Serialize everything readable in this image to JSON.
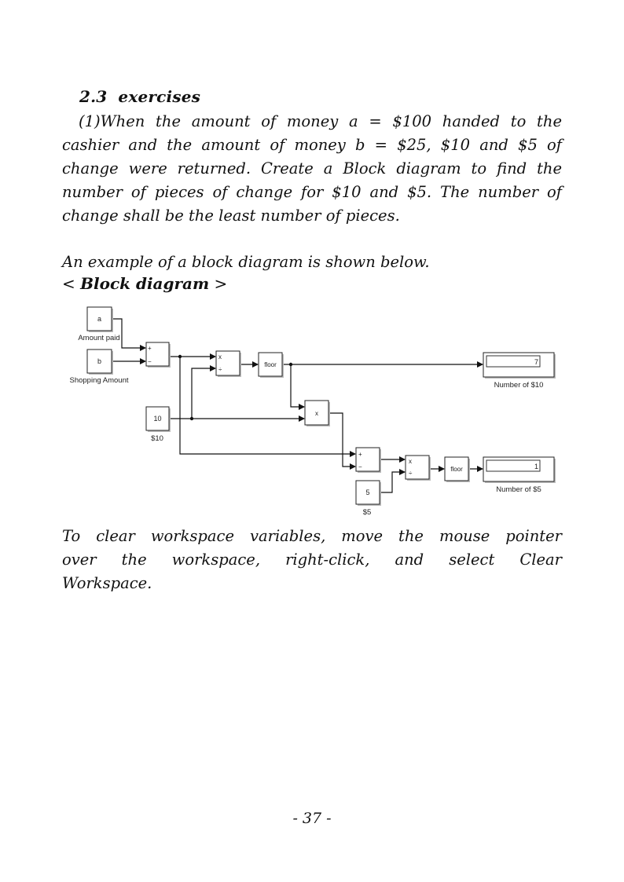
{
  "section": {
    "number": "2.3",
    "title": "exercises"
  },
  "exercise": {
    "text": "(1)When the amount of money a = $100 handed to the cashier and the amount of money b = $25, $10 and $5 of change were returned. Create a Block diagram to find the number of pieces of change for $10 and $5. The number of change shall be the least number of pieces."
  },
  "intro": "An example of a block diagram is shown below.",
  "caption": {
    "open": "< ",
    "title": "Block diagram",
    "close": " >"
  },
  "diagram": {
    "blocks": {
      "const_a": {
        "text": "a",
        "label": "Amount paid"
      },
      "const_b": {
        "text": "b",
        "label": "Shopping Amount"
      },
      "sum1": {
        "port1": "+",
        "port2": "−"
      },
      "divide1": {
        "port1": "x",
        "port2": "÷"
      },
      "floor1": {
        "text": "floor"
      },
      "display10": {
        "value": "7",
        "label": "Number of $10"
      },
      "const10": {
        "text": "10",
        "label": "$10"
      },
      "product": {
        "text": "x"
      },
      "sum2": {
        "port1": "+",
        "port2": "−"
      },
      "divide2": {
        "port1": "x",
        "port2": "÷"
      },
      "floor2": {
        "text": "floor"
      },
      "display5": {
        "value": "1",
        "label": "Number of $5"
      },
      "const5": {
        "text": "5",
        "label": "$5"
      }
    }
  },
  "note": {
    "line1": "To clear workspace variables, move the mouse pointer",
    "line2": "over the workspace, right-click, and select Clear",
    "line3": "Workspace."
  },
  "page_number": "- 37 -"
}
